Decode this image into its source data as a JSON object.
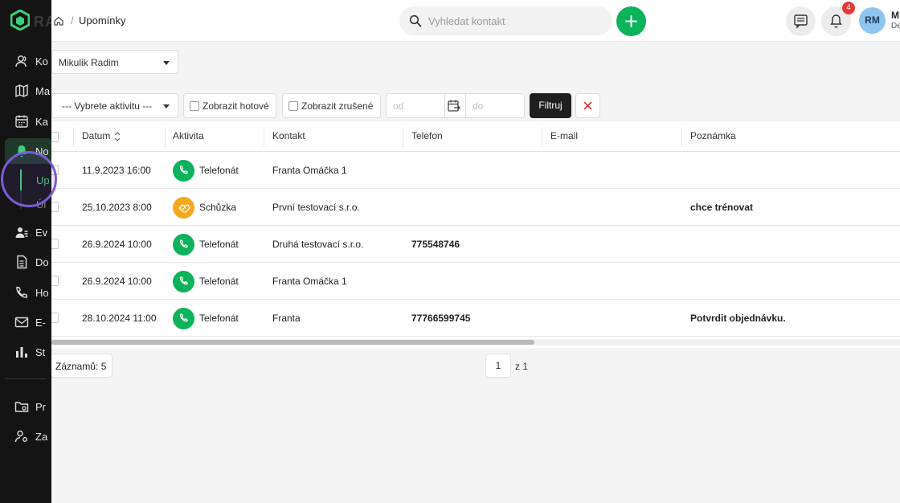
{
  "brand": {
    "logo_text": "RA",
    "accent": "#3ecf7a"
  },
  "sidebar": {
    "items": [
      {
        "label": "Ko",
        "icon": "contacts-icon"
      },
      {
        "label": "Ma",
        "icon": "map-icon"
      },
      {
        "label": "Ka",
        "icon": "calendar-icon"
      },
      {
        "label": "No",
        "icon": "bell-icon"
      },
      {
        "label": "Ev",
        "icon": "user-list-icon"
      },
      {
        "label": "Do",
        "icon": "document-icon"
      },
      {
        "label": "Ho",
        "icon": "phone-icon"
      },
      {
        "label": "E-",
        "icon": "mail-icon"
      },
      {
        "label": "St",
        "icon": "chart-icon"
      },
      {
        "label": "Pr",
        "icon": "folder-icon"
      },
      {
        "label": "Za",
        "icon": "settings-user-icon"
      }
    ],
    "sub_items": [
      {
        "label": "Up",
        "active": true
      },
      {
        "label": "Úl",
        "active": false
      }
    ]
  },
  "header": {
    "breadcrumb_sep": "/",
    "breadcrumb_current": "Upomínky",
    "search_placeholder": "Vyhledat kontakt",
    "notification_count": "4",
    "avatar_initials": "RM",
    "user_name_partial": "M",
    "user_role_partial": "De"
  },
  "filters": {
    "user_select": "Mikulik Radim",
    "activity_select": "--- Vybrete aktivitu ---",
    "show_done_label": "Zobrazit hotové",
    "show_cancelled_label": "Zobrazit zrušené",
    "date_from_placeholder": "od",
    "date_to_placeholder": "do",
    "filter_button": "Filtruj"
  },
  "table": {
    "columns": [
      "Datum",
      "Aktivita",
      "Kontakt",
      "Telefon",
      "E-mail",
      "Poznámka"
    ],
    "rows": [
      {
        "datum": "11.9.2023 16:00",
        "aktivita": "Telefonát",
        "type": "phone",
        "kontakt": "Franta Omáčka 1",
        "telefon": "",
        "email": "",
        "poznamka": ""
      },
      {
        "datum": "25.10.2023 8:00",
        "aktivita": "Schůzka",
        "type": "meeting",
        "kontakt": "První testovací s.r.o.",
        "telefon": "",
        "email": "",
        "poznamka": "chce trénovat"
      },
      {
        "datum": "26.9.2024 10:00",
        "aktivita": "Telefonát",
        "type": "phone",
        "kontakt": "Druhá testovací s.r.o.",
        "telefon": "775548746",
        "email": "",
        "poznamka": ""
      },
      {
        "datum": "26.9.2024 10:00",
        "aktivita": "Telefonát",
        "type": "phone",
        "kontakt": "Franta Omáčka 1",
        "telefon": "",
        "email": "",
        "poznamka": ""
      },
      {
        "datum": "28.10.2024 11:00",
        "aktivita": "Telefonát",
        "type": "phone",
        "kontakt": "Franta",
        "telefon": "77766599745",
        "email": "",
        "poznamka": "Potvrdit objednávku."
      }
    ]
  },
  "footer": {
    "records_label": "Záznamů: 5",
    "current_page": "1",
    "page_of": "z 1"
  },
  "colors": {
    "phone": "#0bb35a",
    "meeting": "#f4a91d",
    "primary_button": "#0bb35a",
    "badge": "#e53935"
  }
}
